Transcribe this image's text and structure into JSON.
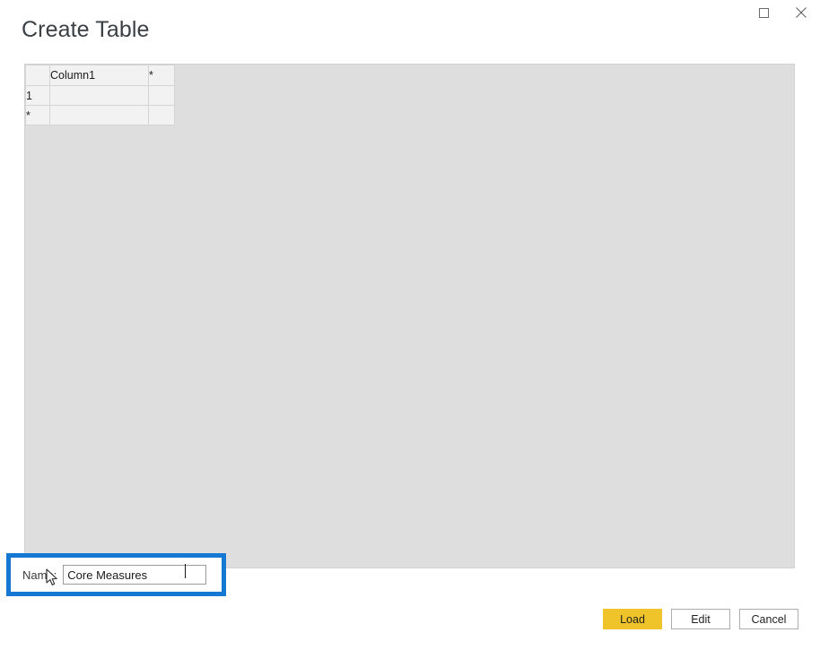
{
  "window": {
    "controls": [
      {
        "name": "maximize-button",
        "icon": "maximize-icon",
        "label": "Maximize"
      },
      {
        "name": "close-button",
        "icon": "close-icon",
        "label": "Close"
      }
    ]
  },
  "dialog": {
    "title": "Create Table"
  },
  "grid": {
    "column_headers": [
      "",
      "Column1",
      "*"
    ],
    "rows": [
      {
        "header": "1",
        "cells": [
          "",
          ""
        ]
      },
      {
        "header": "*",
        "cells": [
          "",
          ""
        ]
      }
    ],
    "new_row_marker": "*",
    "new_column_marker": "*",
    "panel_color": "#dedede",
    "selected_cell_color": "#e4e4e4"
  },
  "name_field": {
    "label": "Name:",
    "value": "Core Measures",
    "placeholder": "",
    "highlight_color": "#1578d3"
  },
  "footer": {
    "buttons": [
      {
        "name": "load-button",
        "label": "Load",
        "style": "primary",
        "color": "#efc42b"
      },
      {
        "name": "edit-button",
        "label": "Edit",
        "style": "secondary"
      },
      {
        "name": "cancel-button",
        "label": "Cancel",
        "style": "secondary"
      }
    ]
  },
  "cursor": {
    "icon": "arrow-pointer-icon"
  }
}
